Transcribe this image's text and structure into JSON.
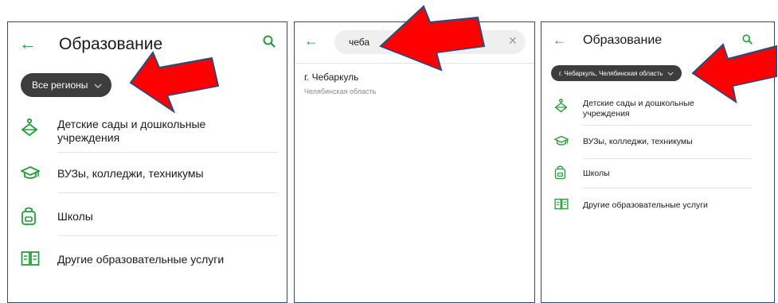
{
  "colors": {
    "accent": "#21a038",
    "chip_bg": "#3d3d3d",
    "arrow_fill": "#ff0000",
    "arrow_stroke": "#2f4a78",
    "panel_border": "#2f4a78"
  },
  "panel1": {
    "title": "Образование",
    "region_chip": "Все регионы",
    "categories": [
      {
        "icon": "kindergarten-icon",
        "label": "Детские сады и дошкольные учреждения"
      },
      {
        "icon": "graduation-cap-icon",
        "label": "ВУЗы, колледжи, техникумы"
      },
      {
        "icon": "backpack-icon",
        "label": "Школы"
      },
      {
        "icon": "open-book-icon",
        "label": "Другие образовательные услуги"
      }
    ]
  },
  "panel2": {
    "search_value": "чеба",
    "results": [
      {
        "city": "г. Чебаркуль",
        "region": "Челябинская область"
      }
    ]
  },
  "panel3": {
    "title": "Образование",
    "region_chip": "г. Чебаркуль, Челябинская область",
    "categories": [
      {
        "icon": "kindergarten-icon",
        "label": "Детские сады и дошкольные учреждения"
      },
      {
        "icon": "graduation-cap-icon",
        "label": "ВУЗы, колледжи, техникумы"
      },
      {
        "icon": "backpack-icon",
        "label": "Школы"
      },
      {
        "icon": "open-book-icon",
        "label": "Другие образовательные услуги"
      }
    ]
  }
}
